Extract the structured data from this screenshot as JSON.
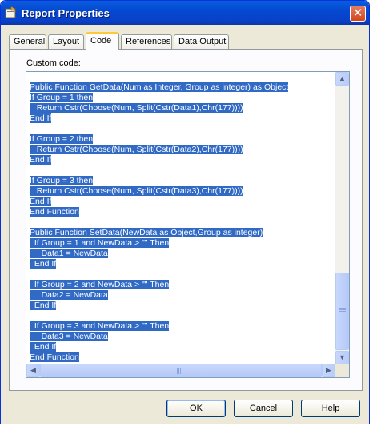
{
  "window": {
    "title": "Report Properties",
    "close_glyph": "✕"
  },
  "tabs": [
    {
      "label": "General",
      "active": false
    },
    {
      "label": "Layout",
      "active": false
    },
    {
      "label": "Code",
      "active": true
    },
    {
      "label": "References",
      "active": false
    },
    {
      "label": "Data Output",
      "active": false
    }
  ],
  "code_panel": {
    "label": "Custom code:",
    "lines": [
      "Public Function GetData(Num as Integer, Group as integer) as Object",
      "If Group = 1 then",
      "   Return Cstr(Choose(Num, Split(Cstr(Data1),Chr(177))))",
      "End If",
      "",
      "If Group = 2 then",
      "   Return Cstr(Choose(Num, Split(Cstr(Data2),Chr(177))))",
      "End If",
      "",
      "If Group = 3 then",
      "   Return Cstr(Choose(Num, Split(Cstr(Data3),Chr(177))))",
      "End If",
      "End Function",
      "",
      "Public Function SetData(NewData as Object,Group as integer)",
      "  If Group = 1 and NewData > \"\" Then",
      "     Data1 = NewData",
      "  End If",
      "",
      "  If Group = 2 and NewData > \"\" Then",
      "     Data2 = NewData",
      "  End If",
      "",
      "  If Group = 3 and NewData > \"\" Then",
      "     Data3 = NewData",
      "  End If",
      "End Function"
    ]
  },
  "scroll_arrows": {
    "up": "▲",
    "down": "▼",
    "left": "◀",
    "right": "▶"
  },
  "buttons": {
    "ok": "OK",
    "cancel": "Cancel",
    "help": "Help"
  },
  "colors": {
    "selection": "#316ac5",
    "titlebar": "#0a5ddf",
    "active_tab_accent": "#ffc83c"
  },
  "icons": {
    "title": "report-properties-icon",
    "close": "close-icon"
  }
}
